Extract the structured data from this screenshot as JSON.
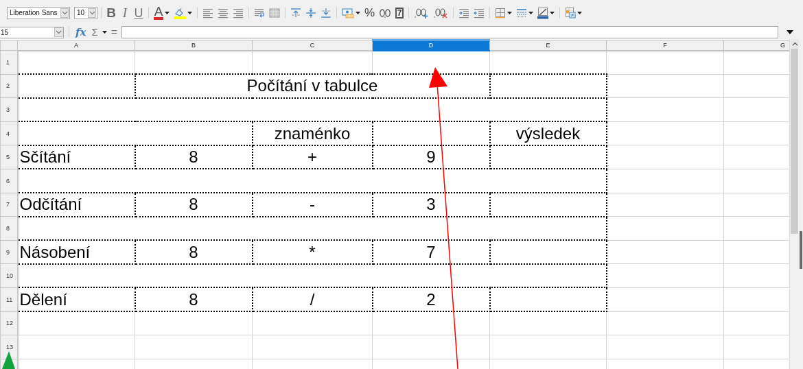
{
  "toolbar": {
    "font_name": "Liberation Sans",
    "font_size": "10",
    "buttons": [
      {
        "kind": "bold",
        "glyph": "B"
      },
      {
        "kind": "italic",
        "glyph": "I"
      },
      {
        "kind": "underline",
        "glyph": "U"
      },
      {
        "kind": "separator"
      },
      {
        "kind": "font-color",
        "glyph": "A"
      },
      {
        "kind": "menu-caret"
      },
      {
        "kind": "highlight"
      },
      {
        "kind": "menu-caret"
      },
      {
        "kind": "separator"
      },
      {
        "kind": "align-left"
      },
      {
        "kind": "align-center"
      },
      {
        "kind": "align-right"
      },
      {
        "kind": "separator"
      },
      {
        "kind": "wrap"
      },
      {
        "kind": "merge"
      },
      {
        "kind": "separator"
      },
      {
        "kind": "align-top"
      },
      {
        "kind": "align-middle"
      },
      {
        "kind": "align-bottom"
      },
      {
        "kind": "separator"
      },
      {
        "kind": "currency"
      },
      {
        "kind": "menu-caret"
      },
      {
        "kind": "percent",
        "glyph": "%"
      },
      {
        "kind": "number"
      },
      {
        "kind": "date",
        "glyph": "7"
      },
      {
        "kind": "separator"
      },
      {
        "kind": "add-decimal"
      },
      {
        "kind": "remove-decimal"
      },
      {
        "kind": "separator"
      },
      {
        "kind": "indent"
      },
      {
        "kind": "outdent"
      },
      {
        "kind": "separator"
      },
      {
        "kind": "borders"
      },
      {
        "kind": "menu-caret"
      },
      {
        "kind": "border-style"
      },
      {
        "kind": "menu-caret"
      },
      {
        "kind": "line-color"
      },
      {
        "kind": "menu-caret"
      },
      {
        "kind": "separator"
      },
      {
        "kind": "conditional"
      },
      {
        "kind": "menu-caret"
      }
    ]
  },
  "formula_bar": {
    "name_box": "15",
    "function_wizard": "fx",
    "sum": "Σ",
    "equals": "="
  },
  "sheet": {
    "columns": [
      {
        "label": "A",
        "selected": false
      },
      {
        "label": "B",
        "selected": false
      },
      {
        "label": "C",
        "selected": false
      },
      {
        "label": "D",
        "selected": true
      },
      {
        "label": "E",
        "selected": false
      },
      {
        "label": "F",
        "selected": false
      },
      {
        "label": "G",
        "selected": false
      }
    ],
    "rows": [
      {
        "header": "1",
        "kind": "blank"
      },
      {
        "header": "2",
        "kind": "title",
        "title": "Počítání v tabulce"
      },
      {
        "header": "3",
        "kind": "gap"
      },
      {
        "header": "4",
        "kind": "heading",
        "sign_label": "znaménko",
        "result_label": "výsledek"
      },
      {
        "header": "5",
        "kind": "operation",
        "label": "Sčítání",
        "first": "8",
        "sign": "+",
        "second": "9"
      },
      {
        "header": "6",
        "kind": "gap"
      },
      {
        "header": "7",
        "kind": "operation",
        "label": "Odčítání",
        "first": "8",
        "sign": "-",
        "second": "3"
      },
      {
        "header": "8",
        "kind": "gap"
      },
      {
        "header": "9",
        "kind": "operation",
        "label": "Násobení",
        "first": "8",
        "sign": "*",
        "second": "7"
      },
      {
        "header": "10",
        "kind": "gap"
      },
      {
        "header": "11",
        "kind": "operation",
        "label": "Dělení",
        "first": "8",
        "sign": "/",
        "second": "2"
      },
      {
        "header": "12",
        "kind": "blank"
      },
      {
        "header": "13",
        "kind": "blank"
      }
    ]
  }
}
